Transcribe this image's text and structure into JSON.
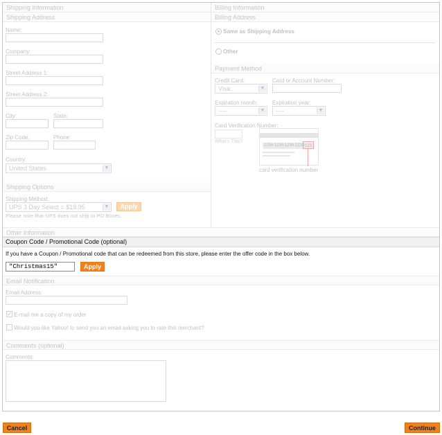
{
  "shipping": {
    "section_title": "Shipping Information",
    "sub_title": "Shipping Address",
    "name_label": "Name:",
    "company_label": "Company:",
    "street1_label": "Street Address 1:",
    "street2_label": "Street Address 2:",
    "city_label": "City:",
    "state_label": "State:",
    "zip_label": "Zip Code:",
    "phone_label": "Phone:",
    "country_label": "Country:",
    "country_value": "United States"
  },
  "shipping_options": {
    "title": "Shipping Options",
    "method_label": "Shipping Method:",
    "method_value": "UPS 3 Day Select = $19.95",
    "apply_label": "Apply",
    "note": "Please note that UPS does not ship to PO Boxes."
  },
  "billing": {
    "section_title": "Billing Information",
    "sub_title": "Billing Address",
    "same_as_shipping": "Same as Shipping Address",
    "other": "Other"
  },
  "payment": {
    "title": "Payment Method",
    "credit_card_label": "Credit Card:",
    "credit_card_value": "Visa",
    "account_label": "Card or Account Number:",
    "exp_month_label": "Expiration month:",
    "exp_month_value": "----",
    "exp_year_label": "Expiration year:",
    "exp_year_value": "----",
    "cvv_label": "Card Verification Number:",
    "whats_this": "What's This?",
    "cvv_sample_digits": "1234 1234 1234 1234",
    "cvv_sample_code": "123",
    "cvv_caption": "card verification number"
  },
  "other_info": {
    "title": "Other Information",
    "coupon_header": "Coupon Code / Promotional Code (optional)",
    "coupon_instructions": "If you have a Coupon / Promotional code that can be redeemed from this store, please enter the offer code in the box below.",
    "coupon_value": "\"Christmas15\"",
    "apply_label": "Apply"
  },
  "email_notification": {
    "title": "Email Notification",
    "email_label": "Email Address:",
    "copy_order_label": "E-mail me a copy of my order",
    "rate_merchant_label": "Would you like Yahoo! to send you an email asking you to rate this merchant?"
  },
  "comments": {
    "title": "Comments (optional)",
    "label": "Comments:"
  },
  "footer": {
    "cancel_label": "Cancel",
    "continue_label": "Continue"
  },
  "colors": {
    "accent_orange": "#f0821e",
    "faded_text": "#c2c2c2",
    "link_blue_faded": "#c3d3ea"
  }
}
